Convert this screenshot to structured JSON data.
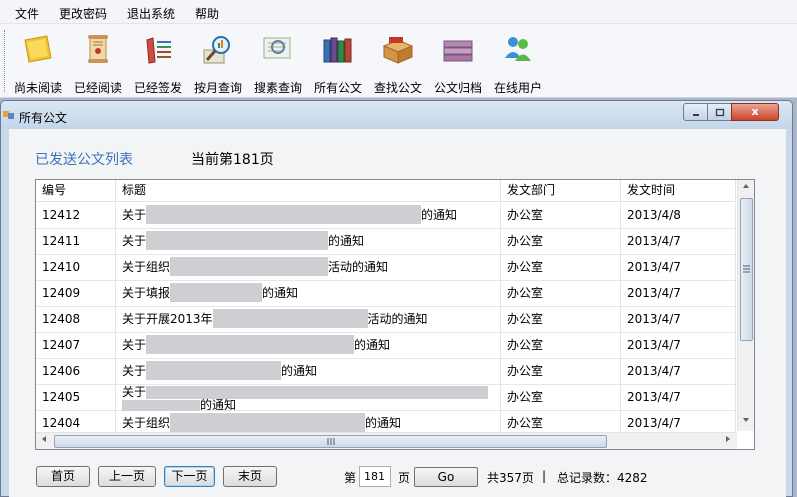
{
  "menu": {
    "items": [
      {
        "label": "文件"
      },
      {
        "label": "更改密码"
      },
      {
        "label": "退出系统"
      },
      {
        "label": "帮助"
      }
    ]
  },
  "toolbar": {
    "buttons": [
      {
        "label": "尚未阅读",
        "icon": "sticky-note-icon"
      },
      {
        "label": "已经阅读",
        "icon": "scroll-icon"
      },
      {
        "label": "已经签发",
        "icon": "books-icon"
      },
      {
        "label": "按月查询",
        "icon": "magnifier-chart-icon"
      },
      {
        "label": "搜素查询",
        "icon": "search-document-icon"
      },
      {
        "label": "所有公文",
        "icon": "book-stack-icon"
      },
      {
        "label": "查找公文",
        "icon": "archive-box-icon"
      },
      {
        "label": "公文归档",
        "icon": "archive-folders-icon"
      },
      {
        "label": "在线用户",
        "icon": "users-icon"
      }
    ]
  },
  "window": {
    "title": "所有公文",
    "list_caption": "已发送公文列表",
    "page_caption": "当前第181页",
    "close_glyph": "x"
  },
  "grid": {
    "columns": [
      "编号",
      "标题",
      "发文部门",
      "发文时间"
    ],
    "rows": [
      {
        "id": "12412",
        "title_pre": "关于",
        "title_post": "的通知",
        "dept": "办公室",
        "date": "2013/4/8"
      },
      {
        "id": "12411",
        "title_pre": "关于",
        "title_post": "的通知",
        "dept": "办公室",
        "date": "2013/4/7"
      },
      {
        "id": "12410",
        "title_pre": "关于组织",
        "title_post": "活动的通知",
        "dept": "办公室",
        "date": "2013/4/7"
      },
      {
        "id": "12409",
        "title_pre": "关于填报",
        "title_post": "的通知",
        "dept": "办公室",
        "date": "2013/4/7"
      },
      {
        "id": "12408",
        "title_pre": "关于开展2013年",
        "title_post": "活动的通知",
        "dept": "办公室",
        "date": "2013/4/7"
      },
      {
        "id": "12407",
        "title_pre": "关于",
        "title_post": "的通知",
        "dept": "办公室",
        "date": "2013/4/7"
      },
      {
        "id": "12406",
        "title_pre": "关于",
        "title_post": "的通知",
        "dept": "办公室",
        "date": "2013/4/7"
      },
      {
        "id": "12405",
        "title_pre": "关于",
        "title_post": "的通知",
        "dept": "办公室",
        "date": "2013/4/7"
      },
      {
        "id": "12404",
        "title_pre": "关于组织",
        "title_post": "的通知",
        "dept": "办公室",
        "date": "2013/4/7"
      }
    ]
  },
  "pager": {
    "first": "首页",
    "prev": "上一页",
    "next": "下一页",
    "last": "末页",
    "page_prefix": "第",
    "page_value": "181",
    "page_suffix": "页",
    "go": "Go",
    "total_pages": "共357页",
    "separator": "|",
    "total_records": "总记录数：4282"
  },
  "colors": {
    "caption_blue": "#3d73b8",
    "mdi_background": "#abb7c8",
    "close_red": "#c9452b"
  }
}
